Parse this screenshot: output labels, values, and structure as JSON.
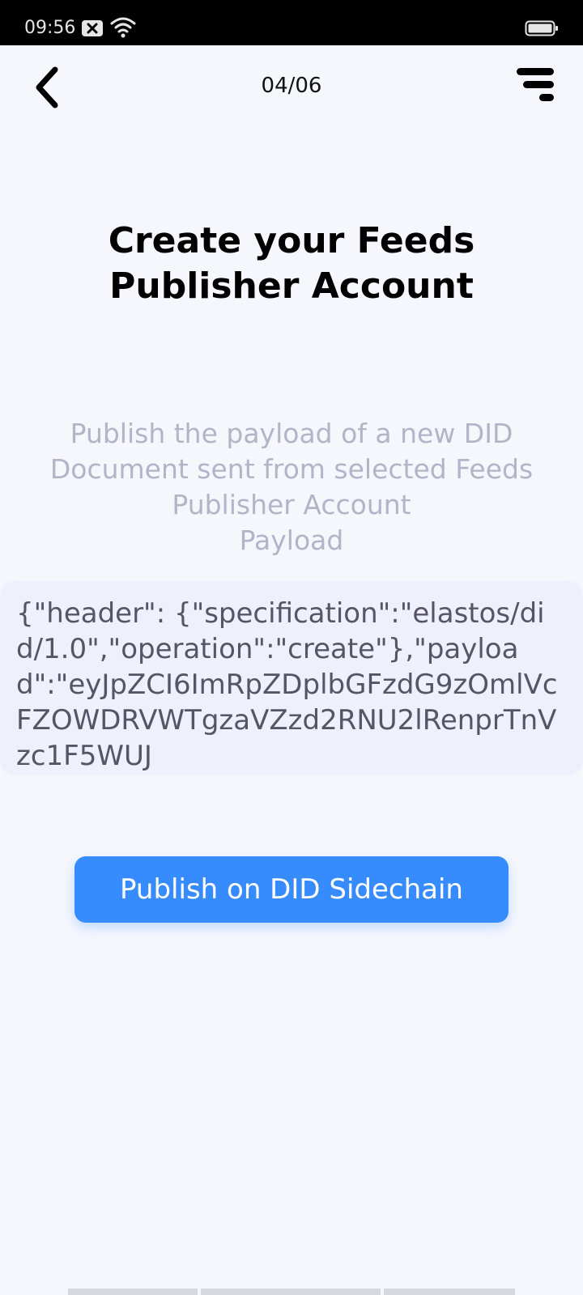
{
  "status_bar": {
    "time": "09:56",
    "icons": [
      "notification-x-icon",
      "wifi-icon",
      "battery-icon"
    ]
  },
  "header": {
    "back_icon": "chevron-left-icon",
    "step": "04/06",
    "menu_icon": "menu-lines-icon"
  },
  "main": {
    "title": "Create your Feeds Publisher Account",
    "description": "Publish the payload of a new DID Document sent from selected Feeds Publisher Account",
    "payload_label": "Payload",
    "payload": "{\"header\": {\"specification\":\"elastos/did/1.0\",\"operation\":\"create\"},\"payload\":\"eyJpZCI6ImRpZDplbGFzdG9zOmlVcFZOWDRVWTgzaVZzd2RNU2lRenprTnVzc1F5WUJ"
  },
  "actions": {
    "publish_label": "Publish on DID Sidechain"
  },
  "colors": {
    "background": "#f6f7fd",
    "accent": "#368bff",
    "payload_bg": "#eef0fc",
    "muted_text": "#b2b4c7"
  }
}
